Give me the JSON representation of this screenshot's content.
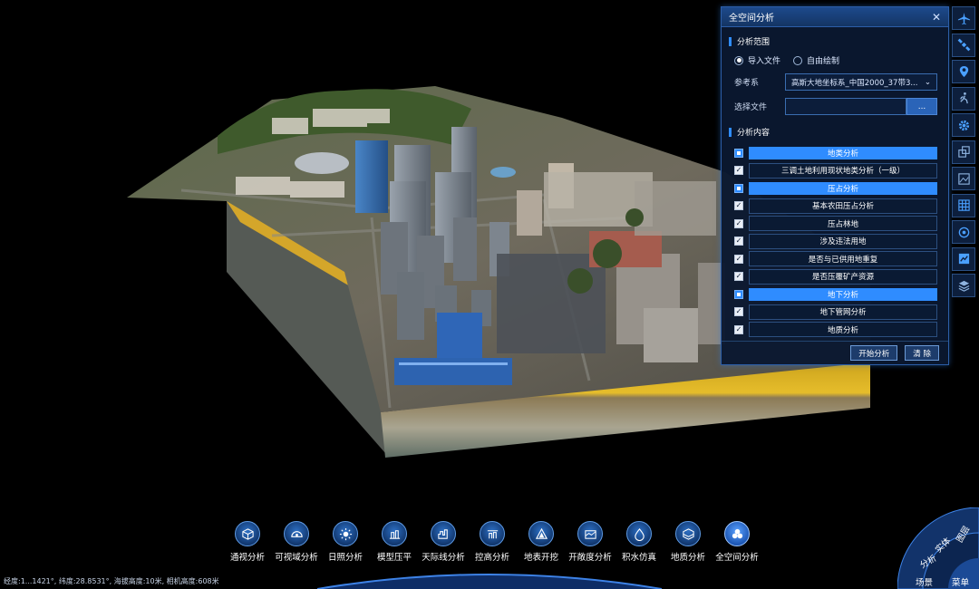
{
  "panel": {
    "title": "全空间分析",
    "close": "✕",
    "range": {
      "heading": "分析范围",
      "options": [
        "导入文件",
        "自由绘制"
      ],
      "selected": "导入文件"
    },
    "crs": {
      "label": "参考系",
      "value": "高斯大地坐标系_中国2000_37带3...",
      "caret": "⌄"
    },
    "file": {
      "label": "选择文件",
      "value": "",
      "browse": "..."
    },
    "content": {
      "heading": "分析内容",
      "rows": [
        {
          "kind": "category",
          "label": "地类分析"
        },
        {
          "kind": "item",
          "label": "三调土地利用现状地类分析（一级）",
          "checked": true
        },
        {
          "kind": "category",
          "label": "压占分析"
        },
        {
          "kind": "item",
          "label": "基本农田压占分析",
          "checked": true
        },
        {
          "kind": "item",
          "label": "压占林地",
          "checked": true
        },
        {
          "kind": "item",
          "label": "涉及违法用地",
          "checked": true
        },
        {
          "kind": "item",
          "label": "是否与已供用地重复",
          "checked": true
        },
        {
          "kind": "item",
          "label": "是否压覆矿产资源",
          "checked": true
        },
        {
          "kind": "category",
          "label": "地下分析"
        },
        {
          "kind": "item",
          "label": "地下管网分析",
          "checked": true
        },
        {
          "kind": "item",
          "label": "地质分析",
          "checked": true
        }
      ]
    },
    "buttons": {
      "start": "开始分析",
      "clear": "清 除"
    },
    "check_mark": "✓"
  },
  "right_toolbar": {
    "icons": [
      "plane-icon",
      "satellite-icon",
      "location-pin-icon",
      "walk-icon",
      "gear-icon",
      "cube-stack-icon",
      "image-frame-icon",
      "grid-icon",
      "target-icon",
      "chart-panel-icon",
      "layers-icon"
    ]
  },
  "bottom_toolbar": {
    "items": [
      {
        "label": "通视分析",
        "icon": "cube-icon"
      },
      {
        "label": "可视域分析",
        "icon": "eye-dome-icon"
      },
      {
        "label": "日照分析",
        "icon": "sun-icon"
      },
      {
        "label": "模型压平",
        "icon": "flatten-icon"
      },
      {
        "label": "天际线分析",
        "icon": "skyline-icon"
      },
      {
        "label": "控高分析",
        "icon": "height-control-icon"
      },
      {
        "label": "地表开挖",
        "icon": "excavation-icon"
      },
      {
        "label": "开敞度分析",
        "icon": "openness-icon"
      },
      {
        "label": "积水仿真",
        "icon": "water-drop-icon"
      },
      {
        "label": "地质分析",
        "icon": "geology-cube-icon"
      },
      {
        "label": "全空间分析",
        "icon": "full-space-icon",
        "active": true
      }
    ]
  },
  "status": {
    "text": "经度:1...1421°, 纬度:28.8531°, 海拔高度:10米, 相机高度:608米"
  },
  "corner_menu": {
    "items": [
      "图层",
      "实体",
      "分析",
      "场景",
      "菜单"
    ]
  },
  "colors": {
    "accent": "#2f8cff",
    "panel_bg": "#0a1830",
    "border": "#2c5ea8",
    "geology_yellow": "#e0b321"
  }
}
